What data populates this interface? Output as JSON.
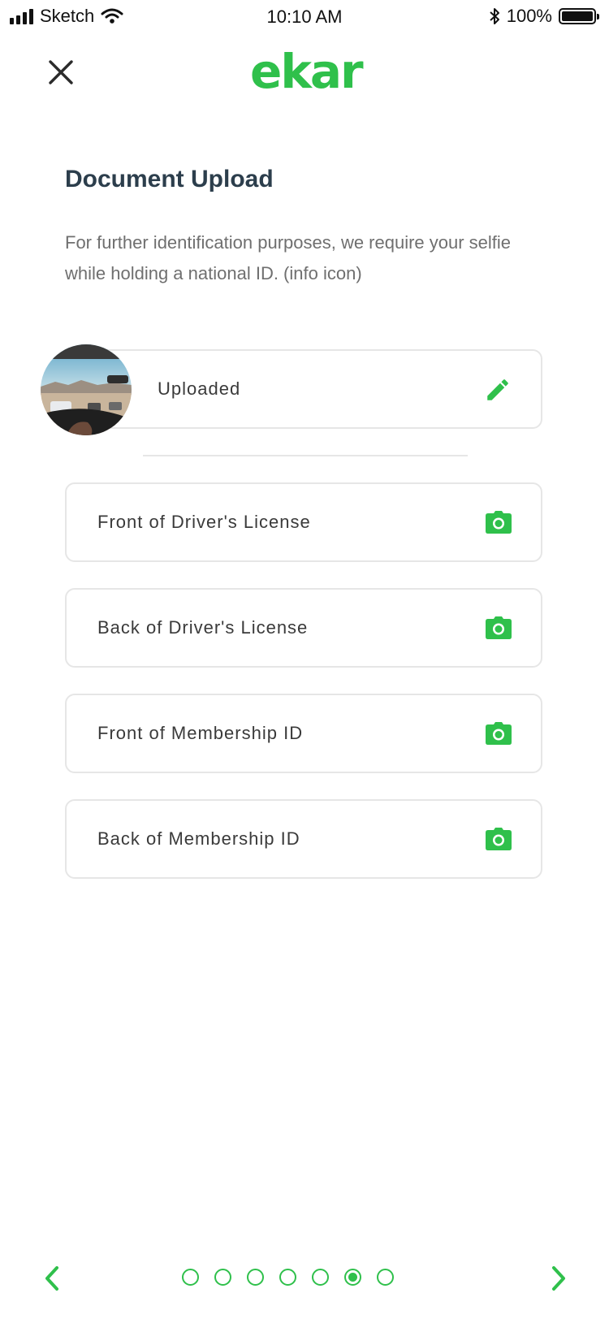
{
  "status_bar": {
    "carrier": "Sketch",
    "time": "10:10 AM",
    "battery": "100%"
  },
  "header": {
    "logo": "ekar",
    "close_icon": "close-icon"
  },
  "page": {
    "title": "Document Upload",
    "description": "For further identification purposes, we require your selfie while holding a national ID. (info icon)"
  },
  "selfie": {
    "status": "Uploaded",
    "action_icon": "pencil-icon"
  },
  "documents": [
    {
      "label": "Front of Driver's License",
      "icon": "camera-icon"
    },
    {
      "label": "Back of Driver's License",
      "icon": "camera-icon"
    },
    {
      "label": "Front of Membership ID",
      "icon": "camera-icon"
    },
    {
      "label": "Back of Membership ID",
      "icon": "camera-icon"
    }
  ],
  "pager": {
    "total_steps": 7,
    "current_step": 6,
    "prev_icon": "chevron-left-icon",
    "next_icon": "chevron-right-icon"
  },
  "colors": {
    "accent": "#2fc04b",
    "title": "#2c3e4c",
    "border": "#e6e6e6"
  }
}
